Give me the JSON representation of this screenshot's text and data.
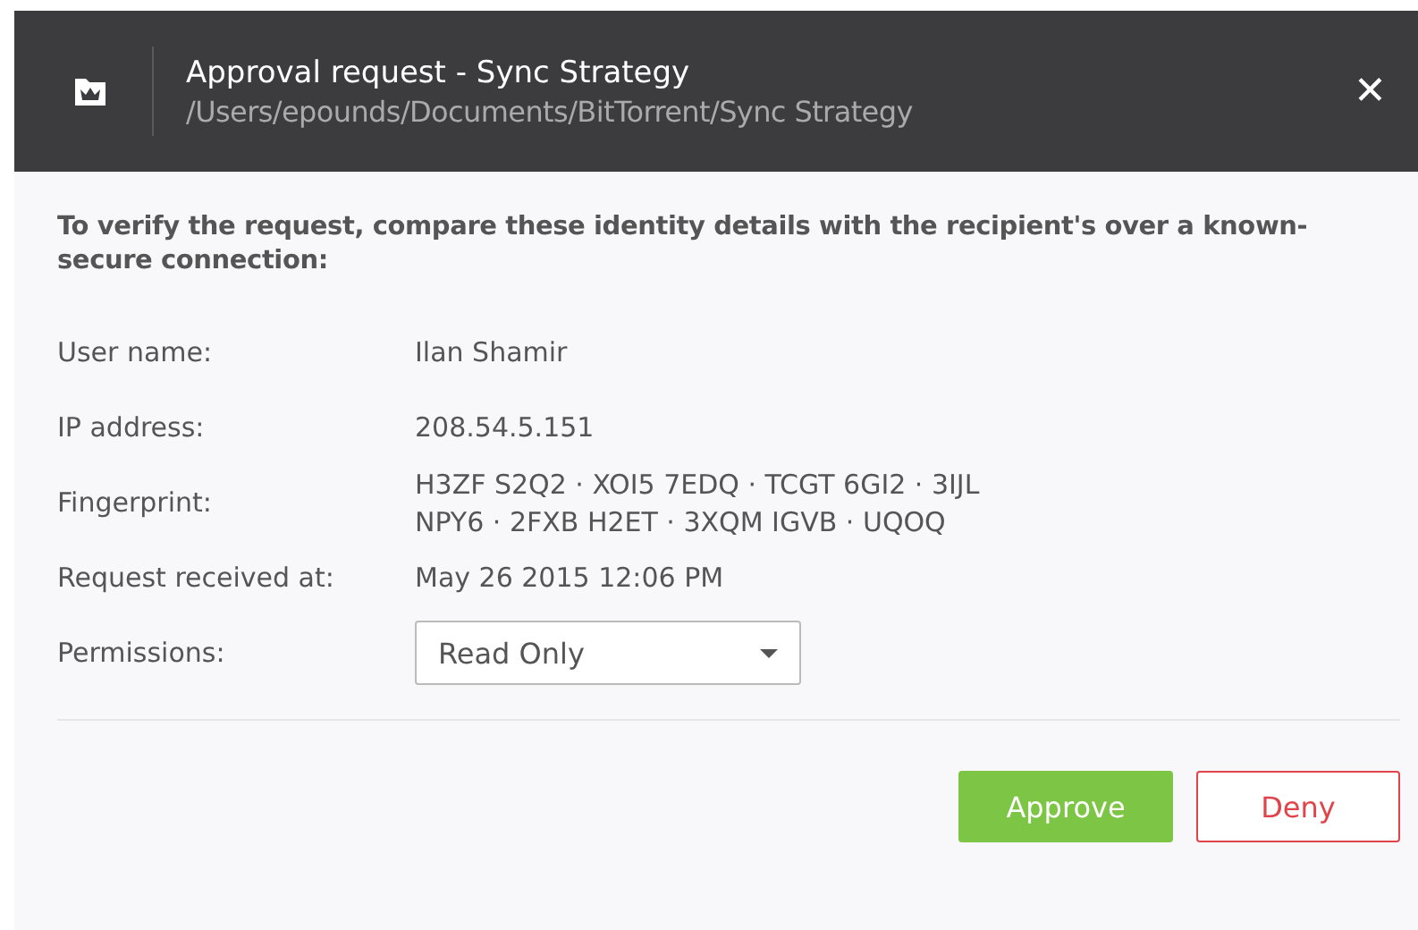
{
  "window": {
    "title": "Approval request - Sync Strategy",
    "path": "/Users/epounds/Documents/BitTorrent/Sync Strategy",
    "close": "✕"
  },
  "intro": "To verify the request, compare these identity details with the recipient's over a known-secure connection:",
  "details": [
    {
      "label": "User name:",
      "lines": [
        "Ilan Shamir"
      ]
    },
    {
      "label": "IP address:",
      "lines": [
        "208.54.5.151"
      ]
    },
    {
      "label": "Fingerprint:",
      "lines": [
        "H3ZF S2Q2 · XOI5 7EDQ · TCGT 6GI2 · 3IJL",
        "NPY6 · 2FXB H2ET · 3XQM IGVB · UQOQ"
      ]
    },
    {
      "label": "Request received at:",
      "lines": [
        "May 26 2015 12:06 PM"
      ]
    }
  ],
  "permissions": {
    "label": "Permissions:",
    "value": "Read Only"
  },
  "buttons": [
    {
      "label": "Approve",
      "kind": "primary"
    },
    {
      "label": "Deny",
      "kind": "danger"
    }
  ]
}
